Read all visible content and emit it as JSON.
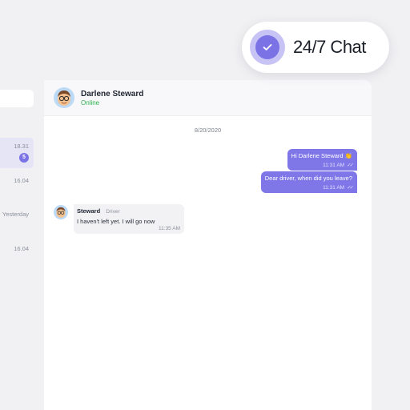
{
  "badge": {
    "label": "24/7 Chat",
    "icon": "check-icon",
    "accent": "#7a72e5"
  },
  "sidebar": {
    "items": [
      {
        "time": "18.31",
        "unread": "5",
        "active": true
      },
      {
        "time": "16.04"
      },
      {
        "time": "Yesterday"
      },
      {
        "time": "16.04"
      }
    ]
  },
  "chat": {
    "contact": {
      "name": "Darlene Steward",
      "status": "Online",
      "status_color": "#2bb24c",
      "avatar_icon": "avatar-emoji-glasses"
    },
    "date": "8/20/2020",
    "messages": [
      {
        "direction": "outgoing",
        "text": "Hi Darlene Steward 👏",
        "time": "11:31 AM",
        "read": true
      },
      {
        "direction": "outgoing",
        "text": "Dear driver, when did you leave?",
        "time": "11:31 AM",
        "read": true
      },
      {
        "direction": "incoming",
        "sender": "Steward",
        "role": "Driver",
        "text": "I haven't left yet. I will go now",
        "time": "11:35 AM"
      }
    ]
  }
}
